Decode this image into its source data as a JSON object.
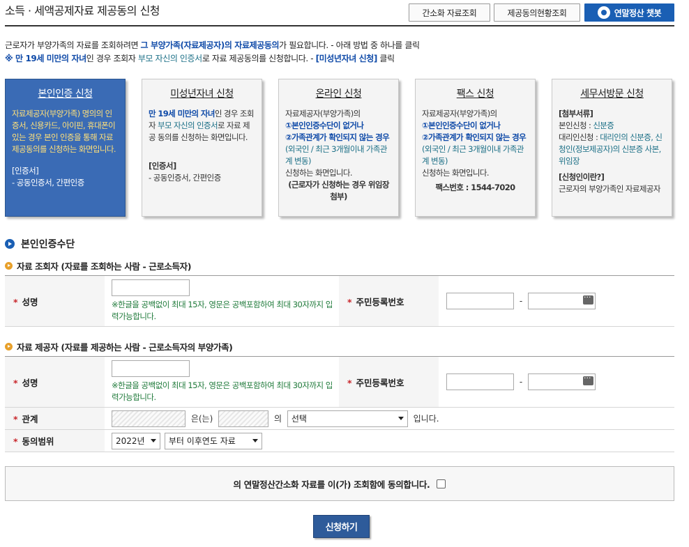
{
  "header": {
    "title": "소득 · 세액공제자료 제공동의 신청",
    "btn_simple_lookup": "간소화 자료조회",
    "btn_consent_status": "제공동의현황조회",
    "btn_chatbot": "연말정산 챗봇"
  },
  "intro": {
    "line1_a": "근로자가 부양가족의 자료를 조회하려면 ",
    "line1_b": "그 부양가족(자료제공자)의 자료제공동의",
    "line1_c": "가 필요합니다. - 아래 방법 중 하나를 클릭",
    "line2_a": "※ 만 19세 미만의 자녀",
    "line2_b": "인 경우 조회자 ",
    "line2_c": "부모 자신의 인증서",
    "line2_d": "로 자료 제공동의를 신청합니다. - ",
    "line2_e": "[미성년자녀 신청]",
    "line2_f": " 클릭"
  },
  "cards": {
    "self": {
      "title": "본인인증 신청",
      "body": "자료제공자(부양가족) 명의의 인증서, 신용카드, 아이핀, 휴대폰이 있는 경우 본인 인증을 통해 자료제공동의를 신청하는 화면입니다.",
      "foot_title": "[인증서]",
      "foot_text": "- 공동인증서, 간편인증"
    },
    "minor": {
      "title": "미성년자녀 신청",
      "body_a": "만 19세 미만의 자녀",
      "body_b": "인 경우 조회자 ",
      "body_c": "부모 자신의 인증서",
      "body_d": "로 자료 제공 동의를 신청하는 화면입니다.",
      "foot_title": "[인증서]",
      "foot_text": "- 공동인증서, 간편인증"
    },
    "online": {
      "title": "온라인 신청",
      "body_a": "자료제공자(부양가족)의",
      "body_b": "①본인인증수단이 없거나",
      "body_c": "②가족관계가 확인되지 않는 경우",
      "body_d": "(외국인 / 최근 3개월이내 가족관계 변동)",
      "body_e": "신청하는 화면입니다.",
      "body_f": "(근로자가 신청하는 경우 위임장 첨부)"
    },
    "fax": {
      "title": "팩스 신청",
      "body_a": "자료제공자(부양가족)의",
      "body_b": "①본인인증수단이 없거나",
      "body_c": "②가족관계가 확인되지 않는 경우",
      "body_d": "(외국인 / 최근 3개월이내 가족관계 변동)",
      "body_e": "신청하는 화면입니다.",
      "fax_number": "팩스번호 : 1544-7020"
    },
    "visit": {
      "title": "세무서방문 신청",
      "docs_title": "[첨부서류]",
      "self_label": "본인신청 : ",
      "self_value": "신분증",
      "proxy_label": "대리인신청 : ",
      "proxy_value": "대리인의 신분증, 신청인(정보제공자)의 신분증 사본, 위임장",
      "who_title": "[신청인이란?]",
      "who_text": "근로자의 부양가족인 자료제공자"
    }
  },
  "section": {
    "title": "본인인증수단"
  },
  "lookup": {
    "title": "자료 조회자 (자료를 조회하는 사람 - 근로소득자)",
    "name_label": "성명",
    "name_value": "",
    "name_hint": "※한글을 공백없이 최대 15자, 영문은 공백포함하여 최대 30자까지 입력가능합니다.",
    "rrn_label": "주민등록번호",
    "rrn_dash": "-"
  },
  "provider": {
    "title": "자료 제공자 (자료를 제공하는 사람 - 근로소득자의 부양가족)",
    "name_label": "성명",
    "name_value": "",
    "name_hint": "※한글을 공백없이 최대 15자, 영문은 공백포함하여 최대 30자까지 입력가능합니다.",
    "rrn_label": "주민등록번호",
    "rrn_dash": "-",
    "relation_label": "관계",
    "relation_txt1": "은(는)",
    "relation_txt2": "의",
    "relation_select": "선택",
    "relation_txt3": "입니다.",
    "scope_label": "동의범위",
    "scope_year": "2022년",
    "scope_range": "부터 이후연도 자료"
  },
  "agree": {
    "text": "의 연말정산간소화 자료를 이(가) 조회함에 동의합니다."
  },
  "submit_label": "신청하기",
  "required_mark": "*",
  "colors": {
    "accent_blue": "#1a5fb4",
    "active_card": "#3a6bb5",
    "hint_green": "#1f7a3a",
    "required_red": "#c8262b"
  }
}
